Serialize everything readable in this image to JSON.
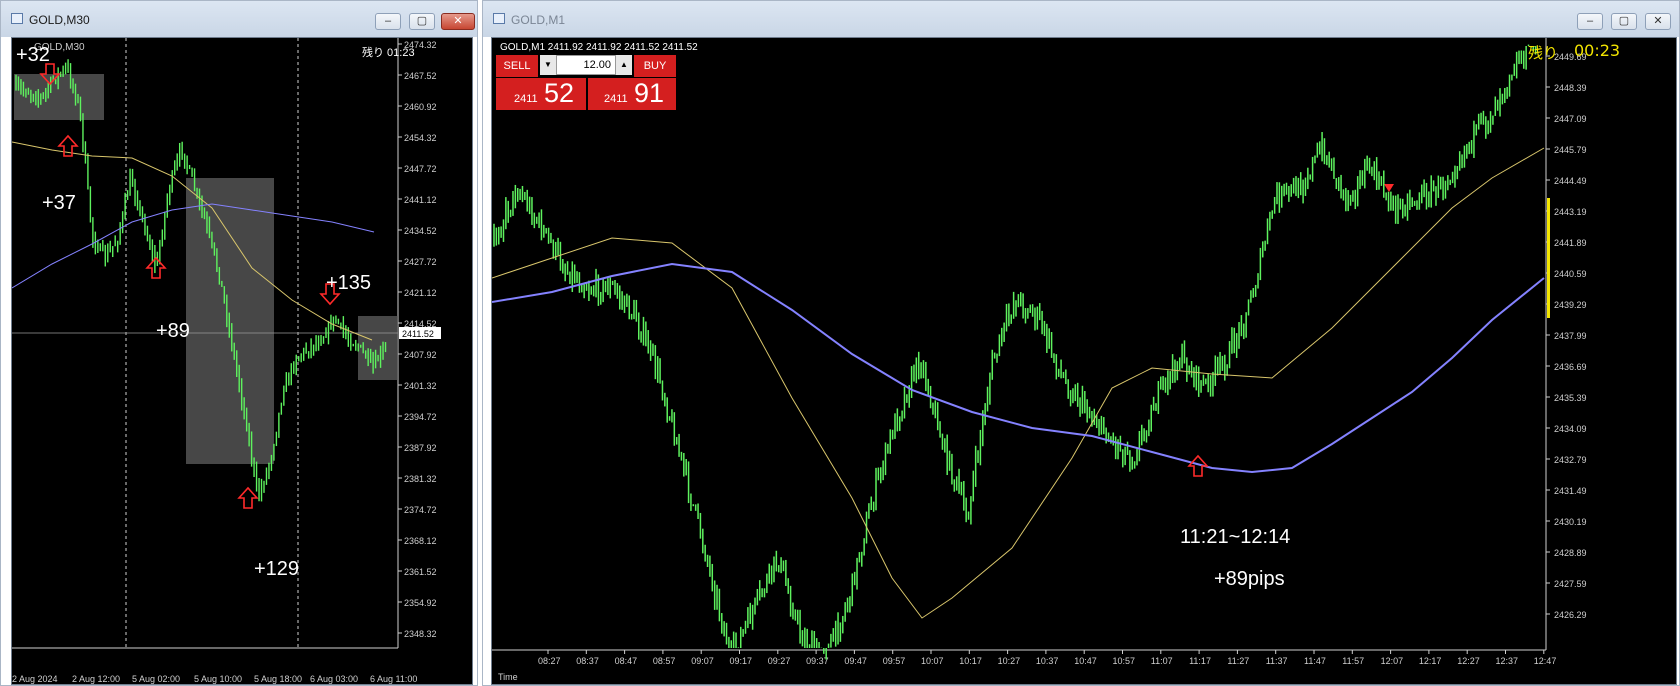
{
  "colors": {
    "bg": "#000000",
    "candle": "#5ef25e",
    "ma_slow": "#8482ff",
    "ma_fast": "#d9c66c",
    "box": "#5f5f5f",
    "arrow": "#ff2a2a",
    "timer_fast": "#f2e400",
    "trade_red": "#d41f1f",
    "price_tag": "#ffffff"
  },
  "left_window": {
    "title": "GOLD,M30",
    "symbol_label": "GOLD,M30",
    "timer": "残り 01:23",
    "price_current": "2411.52",
    "y_axis": [
      "2474.32",
      "2467.52",
      "2460.92",
      "2454.32",
      "2447.72",
      "2441.12",
      "2434.52",
      "2427.72",
      "2421.12",
      "2414.52",
      "2407.92",
      "2401.32",
      "2394.72",
      "2387.92",
      "2381.32",
      "2374.72",
      "2368.12",
      "2361.52",
      "2354.92",
      "2348.32"
    ],
    "x_axis": [
      "2 Aug 2024",
      "2 Aug 12:00",
      "5 Aug 02:00",
      "5 Aug 10:00",
      "5 Aug 18:00",
      "6 Aug 03:00",
      "6 Aug 11:00"
    ],
    "annotations": [
      "+32",
      "+37",
      "+89",
      "+129",
      "+135"
    ],
    "buttons": {
      "minimize": "–",
      "maximize": "▢",
      "close": "✕"
    }
  },
  "right_window": {
    "title": "GOLD,M1",
    "symbol_label": "GOLD,M1  2411.92 2411.92 2411.52 2411.52",
    "timer_label": "残り",
    "timer_value": "00:23",
    "trade": {
      "sell_label": "SELL",
      "buy_label": "BUY",
      "lot": "12.00",
      "sell_prefix": "2411",
      "sell_big": "52",
      "buy_prefix": "2411",
      "buy_big": "91"
    },
    "y_axis": [
      "2449.69",
      "2448.39",
      "2447.09",
      "2445.79",
      "2444.49",
      "2443.19",
      "2441.89",
      "2440.59",
      "2439.29",
      "2437.99",
      "2436.69",
      "2435.39",
      "2434.09",
      "2432.79",
      "2431.49",
      "2430.19",
      "2428.89",
      "2427.59",
      "2426.29"
    ],
    "x_axis": [
      "08:27",
      "08:37",
      "08:47",
      "08:57",
      "09:07",
      "09:17",
      "09:27",
      "09:37",
      "09:47",
      "09:57",
      "10:07",
      "10:17",
      "10:27",
      "10:37",
      "10:47",
      "10:57",
      "11:07",
      "11:17",
      "11:27",
      "11:37",
      "11:47",
      "11:57",
      "12:07",
      "12:17",
      "12:27",
      "12:37",
      "12:47"
    ],
    "time_label": "Time",
    "annotation_time": "11:21~12:14",
    "annotation_pips": "+89pips",
    "buttons": {
      "minimize": "–",
      "maximize": "▢",
      "close": "✕"
    }
  }
}
